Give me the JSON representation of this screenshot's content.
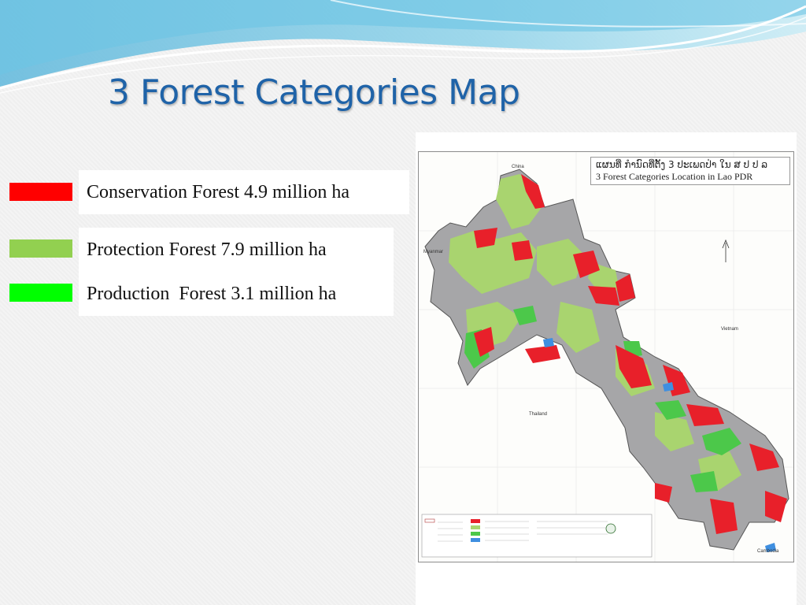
{
  "slide": {
    "title": "3 Forest  Categories Map"
  },
  "legend": [
    {
      "label": "Conservation Forest 4.9 million ha",
      "color": "#ff0000"
    },
    {
      "label": "Protection Forest 7.9 million ha",
      "color": "#92d050"
    },
    {
      "label": "Production  Forest 3.1 million ha",
      "color": "#00ff00"
    }
  ],
  "map": {
    "title_lao": "ແຜນທີ່ ກຳນົດທີ່ຕັ້ງ 3 ປະເພດປ່າ ໃນ ສ ປ ປ ລ",
    "title_en": "3 Forest Categories Location   in Lao PDR",
    "countries": {
      "north": "China",
      "west": "Myanmar",
      "east": "Vietnam",
      "southwest": "Thailand",
      "south": "Cambodia"
    },
    "colors": {
      "conservation": "#e8202a",
      "protection": "#a9d46f",
      "production": "#4cc84a",
      "other_land": "#a6a6a8",
      "water": "#3f8fe0"
    }
  }
}
